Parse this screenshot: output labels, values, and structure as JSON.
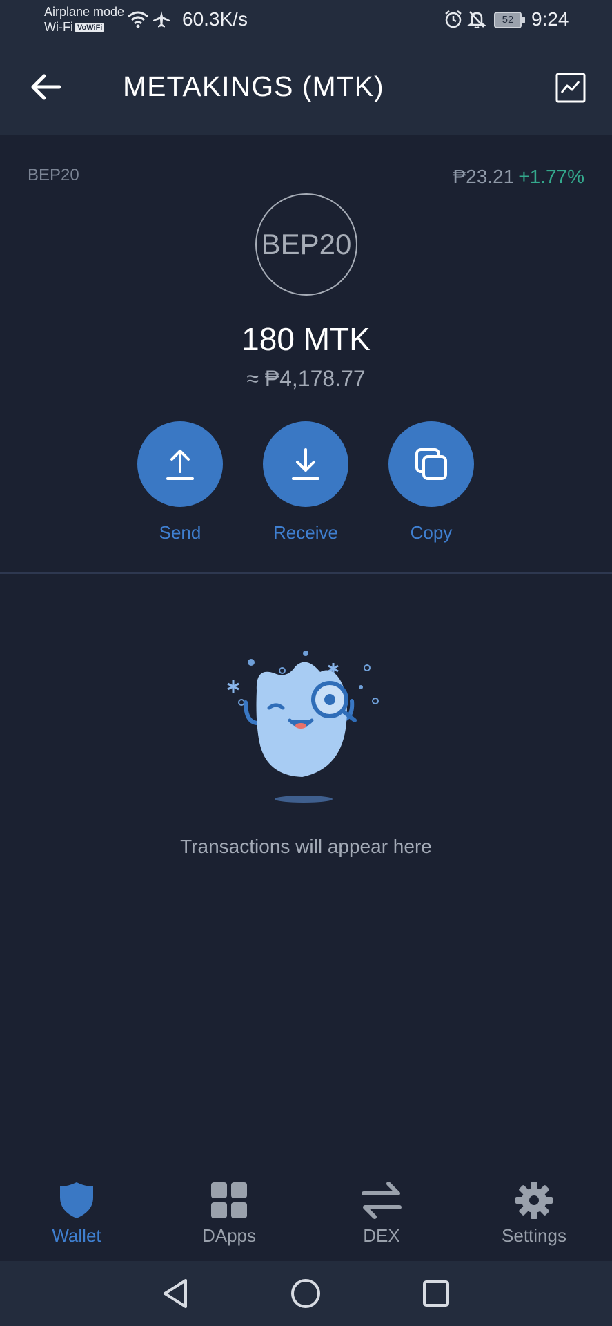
{
  "status_bar": {
    "carrier_line1": "Airplane mode",
    "carrier_line2": "Wi-Fi",
    "wifi_badge": "VoWiFi",
    "speed": "60.3K/s",
    "battery": "52",
    "time": "9:24",
    "icons": [
      "wifi-icon",
      "airplane-icon",
      "alarm-icon",
      "bell-off-icon",
      "battery-icon"
    ]
  },
  "header": {
    "title": "METAKINGS (MTK)",
    "back_icon": "arrow-left-icon",
    "chart_icon": "line-chart-icon"
  },
  "token": {
    "network": "BEP20",
    "logo_text": "BEP20",
    "price": "₱23.21",
    "change": "+1.77%",
    "balance": "180 MTK",
    "fiat_value": "≈ ₱4,178.77"
  },
  "actions": [
    {
      "label": "Send",
      "icon": "upload-icon"
    },
    {
      "label": "Receive",
      "icon": "download-icon"
    },
    {
      "label": "Copy",
      "icon": "copy-icon"
    }
  ],
  "empty_state": {
    "text": "Transactions will appear here"
  },
  "bottom_nav": [
    {
      "label": "Wallet",
      "icon": "shield-icon",
      "active": true
    },
    {
      "label": "DApps",
      "icon": "grid-icon",
      "active": false
    },
    {
      "label": "DEX",
      "icon": "swap-icon",
      "active": false
    },
    {
      "label": "Settings",
      "icon": "gear-icon",
      "active": false
    }
  ],
  "colors": {
    "background": "#1b2131",
    "header": "#232c3d",
    "accent": "#3a78c4",
    "positive": "#34a98d"
  }
}
